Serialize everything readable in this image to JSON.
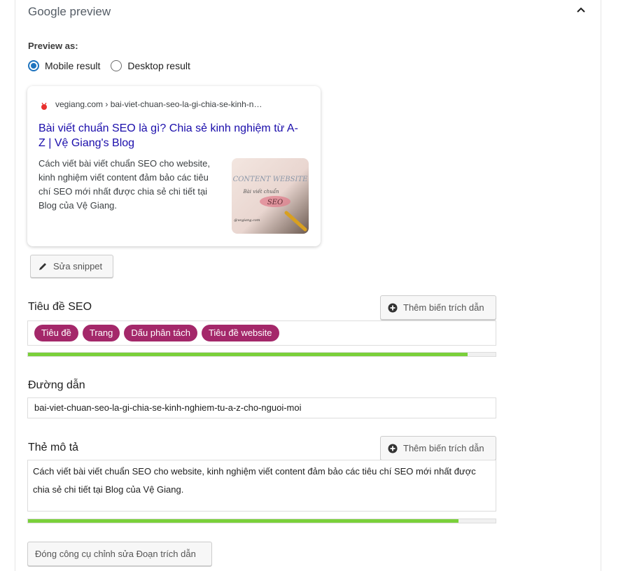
{
  "header": {
    "title": "Google preview"
  },
  "preview": {
    "label": "Preview as:",
    "options": [
      "Mobile result",
      "Desktop result"
    ],
    "selected": "Mobile result"
  },
  "snippet": {
    "breadcrumb": "vegiang.com › bai-viet-chuan-seo-la-gi-chia-se-kinh-n…",
    "title": "Bài viết chuẩn SEO là gì? Chia sẻ kinh nghiệm từ A-Z | Vệ Giang's Blog",
    "description": "Cách viết bài viết chuẩn SEO cho website, kinh nghiệm viết content đảm bảo các tiêu chí SEO mới nhất được chia sẻ chi tiết tại Blog của Vệ Giang.",
    "thumb_text": [
      "CONTENT WEBSITE",
      "Bài viết chuẩn",
      "SEO",
      "@vegiang.com"
    ]
  },
  "buttons": {
    "edit_snippet": "Sửa snippet",
    "insert_variable": "Thêm biến trích dẫn",
    "close_editor": "Đóng công cụ chỉnh sửa Đoạn trích dẫn"
  },
  "seo_title": {
    "label": "Tiêu đề SEO",
    "variables": [
      "Tiêu đề",
      "Trang",
      "Dấu phân tách",
      "Tiêu đề website"
    ],
    "progress": 0.94
  },
  "slug": {
    "label": "Đường dẫn",
    "value": "bai-viet-chuan-seo-la-gi-chia-se-kinh-nghiem-tu-a-z-cho-nguoi-moi"
  },
  "meta": {
    "label": "Thẻ mô tả",
    "value": "Cách viết bài viết chuẩn SEO cho website, kinh nghiệm viết content đảm bảo các tiêu chí SEO mới nhất được chia sẻ chi tiết tại Blog của Vệ Giang.",
    "progress": 0.92
  },
  "colors": {
    "accent": "#1e73be",
    "pill": "#a4286a",
    "progress_good": "#7ad03a",
    "link": "#1a0dab"
  }
}
